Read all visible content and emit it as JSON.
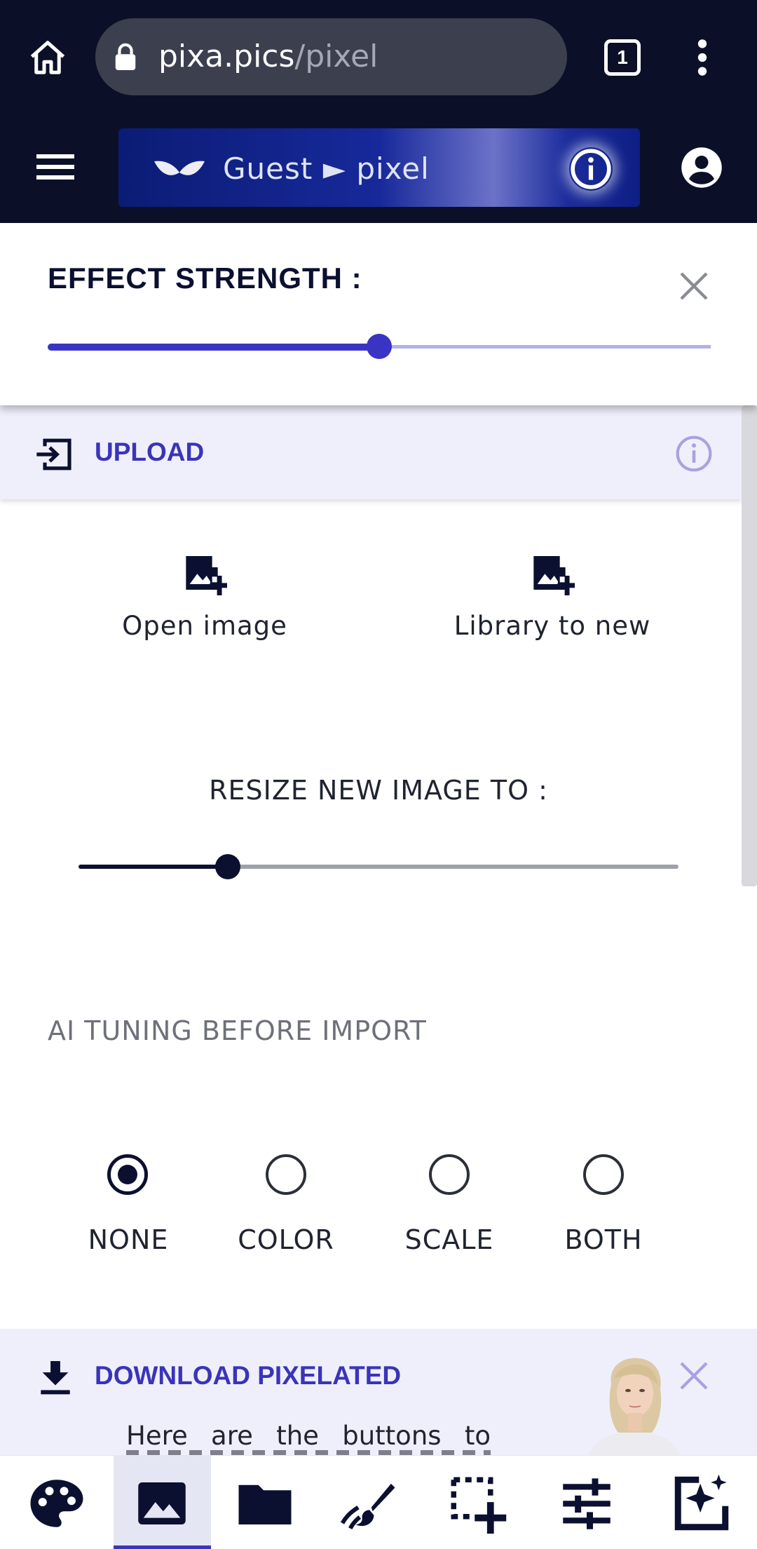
{
  "browser": {
    "url_domain": "pixa.pics",
    "url_path": "/pixel",
    "tab_count": "1"
  },
  "header": {
    "brand": "Guest ► pixel"
  },
  "effect": {
    "title": "EFFECT STRENGTH :",
    "level": 0.5
  },
  "upload": {
    "label": "UPLOAD",
    "actions": [
      {
        "label": "Open image",
        "icon": "add-photo-icon"
      },
      {
        "label": "Library to new",
        "icon": "add-photo-icon"
      }
    ]
  },
  "resize": {
    "title": "RESIZE NEW IMAGE TO :",
    "level": 0.25
  },
  "ai_tuning": {
    "title": "AI TUNING BEFORE IMPORT",
    "options": [
      {
        "label": "NONE",
        "selected": true
      },
      {
        "label": "COLOR",
        "selected": false
      },
      {
        "label": "SCALE",
        "selected": false
      },
      {
        "label": "BOTH",
        "selected": false
      }
    ]
  },
  "download": {
    "title": "DOWNLOAD PIXELATED",
    "text": "Here are the buttons to"
  },
  "toolbar": {
    "tabs": [
      "palette-icon",
      "image-icon",
      "folder-icon",
      "brush-icon",
      "select-add-icon",
      "tune-icon",
      "ai-image-icon"
    ],
    "active": "image-icon"
  },
  "colors": {
    "accent": "#3a34b8",
    "dark": "#0b1028",
    "panel": "#efeffc"
  }
}
